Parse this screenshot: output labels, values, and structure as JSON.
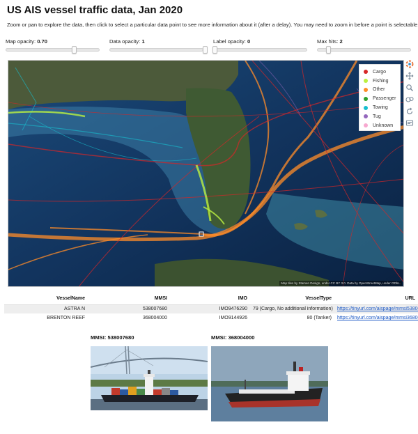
{
  "title": "US AIS vessel traffic data, Jan 2020",
  "instructions": "Zoom or pan to explore the data, then click to select a particular data point to see more information about it (after a delay). You may need to zoom in before a point is selectable.",
  "sliders": [
    {
      "label": "Map opacity:",
      "value": "0.70",
      "fraction": 0.7
    },
    {
      "label": "Data opacity:",
      "value": "1",
      "fraction": 1.0
    },
    {
      "label": "Label opacity:",
      "value": "0",
      "fraction": 0.0
    },
    {
      "label": "Max hits:",
      "value": "2",
      "fraction": 0.11
    }
  ],
  "legend": {
    "items": [
      {
        "label": "Cargo",
        "color": "#d62728"
      },
      {
        "label": "Fishing",
        "color": "#bcf041"
      },
      {
        "label": "Other",
        "color": "#ff8c28"
      },
      {
        "label": "Passenger",
        "color": "#2ca02c"
      },
      {
        "label": "Towing",
        "color": "#17becf"
      },
      {
        "label": "Tug",
        "color": "#9467bd"
      },
      {
        "label": "Unknown",
        "color": "#f7a8d0"
      }
    ]
  },
  "toolbar": {
    "icons": [
      "bokeh-logo-icon",
      "pan-icon",
      "box-zoom-icon",
      "wheel-zoom-icon",
      "reset-icon",
      "hover-icon"
    ]
  },
  "map": {
    "attribution": "Map tiles by Stamen Design, under CC BY 3.0. Data by OpenStreetMap, under ODbL."
  },
  "table": {
    "columns": [
      "VesselName",
      "MMSI",
      "IMO",
      "VesselType",
      "URL"
    ],
    "rows": [
      {
        "name": "ASTRA N",
        "mmsi": "538007680",
        "imo": "IMO9476290",
        "type": "79 (Cargo, No additional information)",
        "url": "https://tinyurl.com/aispage/mmsi538007680"
      },
      {
        "name": "BRENTON REEF",
        "mmsi": "368004000",
        "imo": "IMO9144926",
        "type": "80 (Tanker)",
        "url": "https://tinyurl.com/aispage/mmsi368004000"
      }
    ]
  },
  "photos": [
    {
      "label": "MMSI: 538007680"
    },
    {
      "label": "MMSI: 368004000"
    }
  ]
}
